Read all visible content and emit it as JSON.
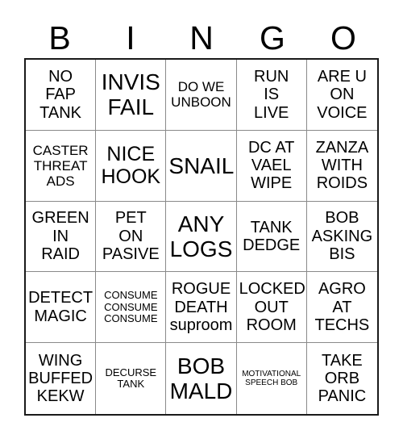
{
  "card": {
    "headers": [
      "B",
      "I",
      "N",
      "G",
      "O"
    ],
    "rows": [
      [
        {
          "text": "NO\nFAP\nTANK",
          "size": "sz-md"
        },
        {
          "text": "INVIS\nFAIL",
          "size": "sz-xl"
        },
        {
          "text": "DO WE\nUNBOON",
          "size": "sz-sm"
        },
        {
          "text": "RUN\nIS\nLIVE",
          "size": "sz-md"
        },
        {
          "text": "ARE U\nON\nVOICE",
          "size": "sz-md"
        }
      ],
      [
        {
          "text": "CASTER\nTHREAT\nADS",
          "size": "sz-sm"
        },
        {
          "text": "NICE\nHOOK",
          "size": "sz-lg"
        },
        {
          "text": "SNAIL",
          "size": "sz-xl"
        },
        {
          "text": "DC AT\nVAEL\nWIPE",
          "size": "sz-md"
        },
        {
          "text": "ZANZA\nWITH\nROIDS",
          "size": "sz-md"
        }
      ],
      [
        {
          "text": "GREEN\nIN\nRAID",
          "size": "sz-md"
        },
        {
          "text": "PET\nON\nPASIVE",
          "size": "sz-md"
        },
        {
          "text": "ANY\nLOGS",
          "size": "sz-xl"
        },
        {
          "text": "TANK\nDEDGE",
          "size": "sz-md"
        },
        {
          "text": "BOB\nASKING\nBIS",
          "size": "sz-md"
        }
      ],
      [
        {
          "text": "DETECT\nMAGIC",
          "size": "sz-md"
        },
        {
          "text": "CONSUME\nCONSUME\nCONSUME",
          "size": "sz-xs"
        },
        {
          "text": "ROGUE\nDEATH\nsuproom",
          "size": "sz-md"
        },
        {
          "text": "LOCKED\nOUT\nROOM",
          "size": "sz-md"
        },
        {
          "text": "AGRO\nAT\nTECHS",
          "size": "sz-md"
        }
      ],
      [
        {
          "text": "WING\nBUFFED\nKEKW",
          "size": "sz-md"
        },
        {
          "text": "DECURSE\nTANK",
          "size": "sz-xs"
        },
        {
          "text": "BOB\nMALD",
          "size": "sz-xl"
        },
        {
          "text": "MOTIVATIONAL\nSPEECH BOB",
          "size": "sz-xxs"
        },
        {
          "text": "TAKE\nORB\nPANIC",
          "size": "sz-md"
        }
      ]
    ]
  }
}
